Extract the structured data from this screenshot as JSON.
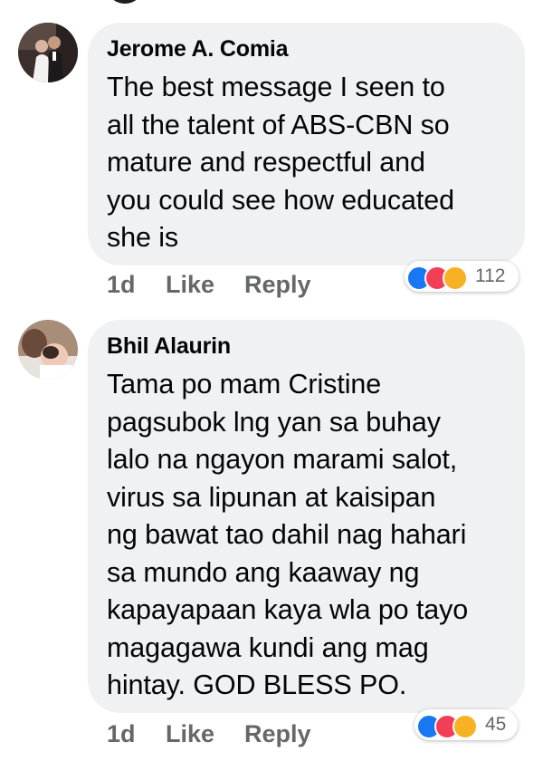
{
  "comments": [
    {
      "author": "Jerome A. Comia",
      "text": "The best message I seen to\nall the talent of ABS-CBN so\nmature and respectful and\nyou could see how educated\nshe is",
      "time": "1d",
      "like_label": "Like",
      "reply_label": "Reply",
      "reaction_count": "112",
      "reaction_icons": [
        "like-icon",
        "love-icon",
        "care-icon"
      ],
      "avatar_icon": "wedding-couple-photo"
    },
    {
      "author": "Bhil Alaurin",
      "text": "Tama po mam Cristine\npagsubok lng yan sa buhay\nlalo na ngayon marami salot,\nvirus sa lipunan at  kaisipan\nng bawat tao dahil nag hahari\nsa mundo ang kaaway ng\nkapayapaan kaya wla po tayo\nmagagawa kundi ang mag\nhintay. GOD BLESS PO.",
      "time": "1d",
      "like_label": "Like",
      "reply_label": "Reply",
      "reaction_count": "45",
      "reaction_icons": [
        "like-icon",
        "love-icon",
        "care-icon"
      ],
      "avatar_icon": "baby-photo"
    }
  ],
  "colors": {
    "bubble": "#eff1f3",
    "meta_text": "#65676b",
    "like": "#1877f2",
    "love": "#f33e58",
    "care": "#f7b125"
  }
}
